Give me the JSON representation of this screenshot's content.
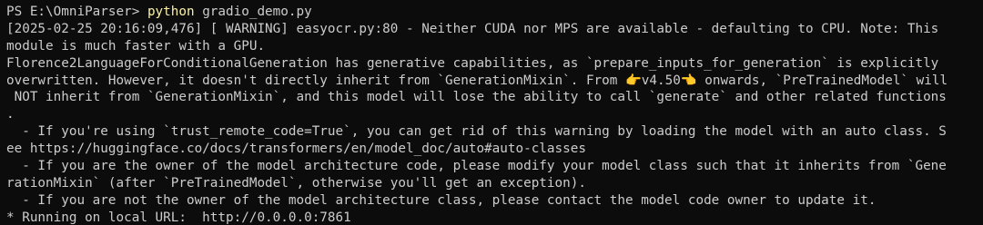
{
  "terminal": {
    "prompt": "PS E:\\OmniParser> ",
    "command": "python",
    "command_args": " gradio_demo.py",
    "output": [
      "[2025-02-25 20:16:09,476] [ WARNING] easyocr.py:80 - Neither CUDA nor MPS are available - defaulting to CPU. Note: This",
      "module is much faster with a GPU.",
      "Florence2LanguageForConditionalGeneration has generative capabilities, as `prepare_inputs_for_generation` is explicitly",
      "overwritten. However, it doesn't directly inherit from `GenerationMixin`. From 👉v4.50👈 onwards, `PreTrainedModel` will",
      " NOT inherit from `GenerationMixin`, and this model will lose the ability to call `generate` and other related functions",
      ".",
      "  - If you're using `trust_remote_code=True`, you can get rid of this warning by loading the model with an auto class. S",
      "ee https://huggingface.co/docs/transformers/en/model_doc/auto#auto-classes",
      "  - If you are the owner of the model architecture code, please modify your model class such that it inherits from `Gene",
      "rationMixin` (after `PreTrainedModel`, otherwise you'll get an exception).",
      "  - If you are not the owner of the model architecture class, please contact the model code owner to update it.",
      "* Running on local URL:  http://0.0.0.0:7861"
    ],
    "colors": {
      "background": "#0c0c0c",
      "text": "#cccccc",
      "command": "#f9f1a5"
    }
  }
}
